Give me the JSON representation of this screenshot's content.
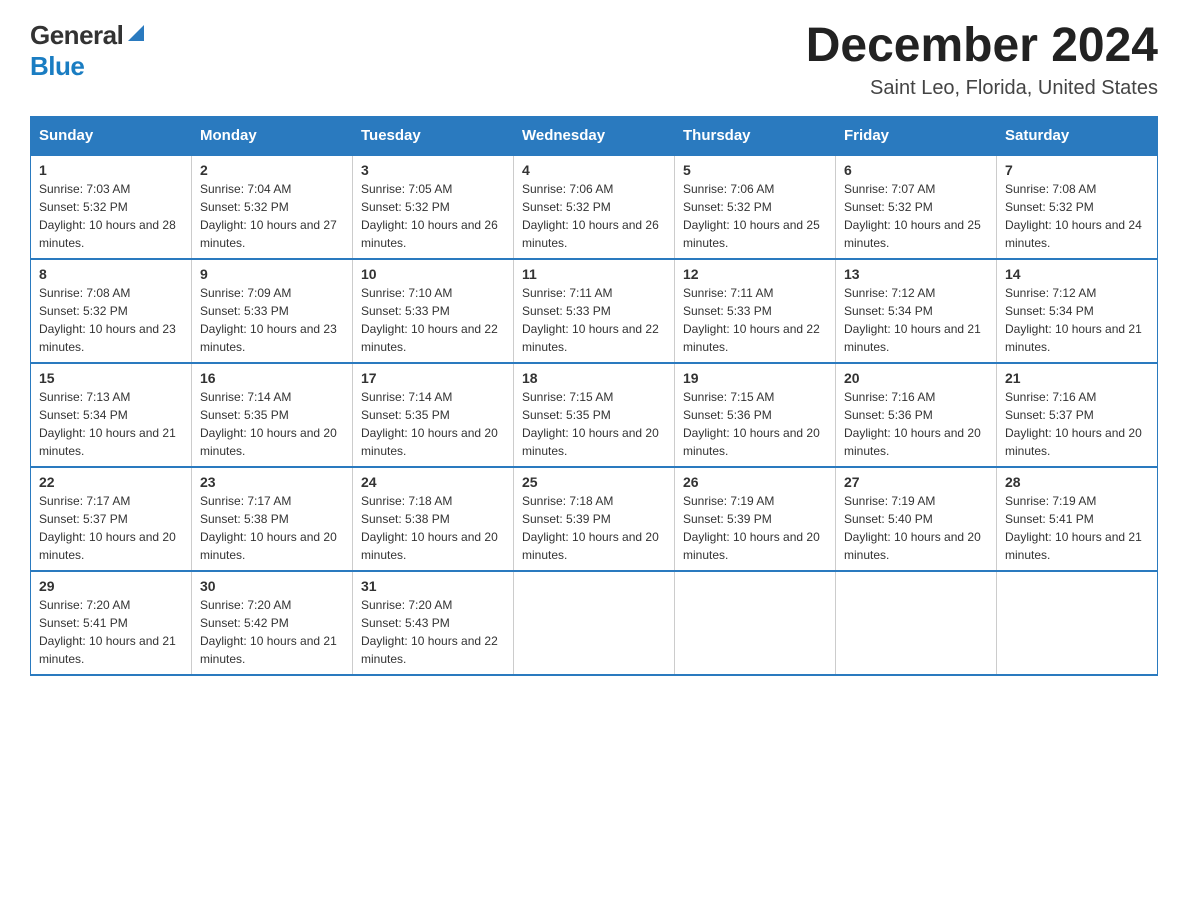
{
  "logo": {
    "general": "General",
    "blue": "Blue"
  },
  "title": "December 2024",
  "location": "Saint Leo, Florida, United States",
  "days_of_week": [
    "Sunday",
    "Monday",
    "Tuesday",
    "Wednesday",
    "Thursday",
    "Friday",
    "Saturday"
  ],
  "weeks": [
    [
      {
        "day": "1",
        "sunrise": "7:03 AM",
        "sunset": "5:32 PM",
        "daylight": "10 hours and 28 minutes."
      },
      {
        "day": "2",
        "sunrise": "7:04 AM",
        "sunset": "5:32 PM",
        "daylight": "10 hours and 27 minutes."
      },
      {
        "day": "3",
        "sunrise": "7:05 AM",
        "sunset": "5:32 PM",
        "daylight": "10 hours and 26 minutes."
      },
      {
        "day": "4",
        "sunrise": "7:06 AM",
        "sunset": "5:32 PM",
        "daylight": "10 hours and 26 minutes."
      },
      {
        "day": "5",
        "sunrise": "7:06 AM",
        "sunset": "5:32 PM",
        "daylight": "10 hours and 25 minutes."
      },
      {
        "day": "6",
        "sunrise": "7:07 AM",
        "sunset": "5:32 PM",
        "daylight": "10 hours and 25 minutes."
      },
      {
        "day": "7",
        "sunrise": "7:08 AM",
        "sunset": "5:32 PM",
        "daylight": "10 hours and 24 minutes."
      }
    ],
    [
      {
        "day": "8",
        "sunrise": "7:08 AM",
        "sunset": "5:32 PM",
        "daylight": "10 hours and 23 minutes."
      },
      {
        "day": "9",
        "sunrise": "7:09 AM",
        "sunset": "5:33 PM",
        "daylight": "10 hours and 23 minutes."
      },
      {
        "day": "10",
        "sunrise": "7:10 AM",
        "sunset": "5:33 PM",
        "daylight": "10 hours and 22 minutes."
      },
      {
        "day": "11",
        "sunrise": "7:11 AM",
        "sunset": "5:33 PM",
        "daylight": "10 hours and 22 minutes."
      },
      {
        "day": "12",
        "sunrise": "7:11 AM",
        "sunset": "5:33 PM",
        "daylight": "10 hours and 22 minutes."
      },
      {
        "day": "13",
        "sunrise": "7:12 AM",
        "sunset": "5:34 PM",
        "daylight": "10 hours and 21 minutes."
      },
      {
        "day": "14",
        "sunrise": "7:12 AM",
        "sunset": "5:34 PM",
        "daylight": "10 hours and 21 minutes."
      }
    ],
    [
      {
        "day": "15",
        "sunrise": "7:13 AM",
        "sunset": "5:34 PM",
        "daylight": "10 hours and 21 minutes."
      },
      {
        "day": "16",
        "sunrise": "7:14 AM",
        "sunset": "5:35 PM",
        "daylight": "10 hours and 20 minutes."
      },
      {
        "day": "17",
        "sunrise": "7:14 AM",
        "sunset": "5:35 PM",
        "daylight": "10 hours and 20 minutes."
      },
      {
        "day": "18",
        "sunrise": "7:15 AM",
        "sunset": "5:35 PM",
        "daylight": "10 hours and 20 minutes."
      },
      {
        "day": "19",
        "sunrise": "7:15 AM",
        "sunset": "5:36 PM",
        "daylight": "10 hours and 20 minutes."
      },
      {
        "day": "20",
        "sunrise": "7:16 AM",
        "sunset": "5:36 PM",
        "daylight": "10 hours and 20 minutes."
      },
      {
        "day": "21",
        "sunrise": "7:16 AM",
        "sunset": "5:37 PM",
        "daylight": "10 hours and 20 minutes."
      }
    ],
    [
      {
        "day": "22",
        "sunrise": "7:17 AM",
        "sunset": "5:37 PM",
        "daylight": "10 hours and 20 minutes."
      },
      {
        "day": "23",
        "sunrise": "7:17 AM",
        "sunset": "5:38 PM",
        "daylight": "10 hours and 20 minutes."
      },
      {
        "day": "24",
        "sunrise": "7:18 AM",
        "sunset": "5:38 PM",
        "daylight": "10 hours and 20 minutes."
      },
      {
        "day": "25",
        "sunrise": "7:18 AM",
        "sunset": "5:39 PM",
        "daylight": "10 hours and 20 minutes."
      },
      {
        "day": "26",
        "sunrise": "7:19 AM",
        "sunset": "5:39 PM",
        "daylight": "10 hours and 20 minutes."
      },
      {
        "day": "27",
        "sunrise": "7:19 AM",
        "sunset": "5:40 PM",
        "daylight": "10 hours and 20 minutes."
      },
      {
        "day": "28",
        "sunrise": "7:19 AM",
        "sunset": "5:41 PM",
        "daylight": "10 hours and 21 minutes."
      }
    ],
    [
      {
        "day": "29",
        "sunrise": "7:20 AM",
        "sunset": "5:41 PM",
        "daylight": "10 hours and 21 minutes."
      },
      {
        "day": "30",
        "sunrise": "7:20 AM",
        "sunset": "5:42 PM",
        "daylight": "10 hours and 21 minutes."
      },
      {
        "day": "31",
        "sunrise": "7:20 AM",
        "sunset": "5:43 PM",
        "daylight": "10 hours and 22 minutes."
      },
      null,
      null,
      null,
      null
    ]
  ]
}
